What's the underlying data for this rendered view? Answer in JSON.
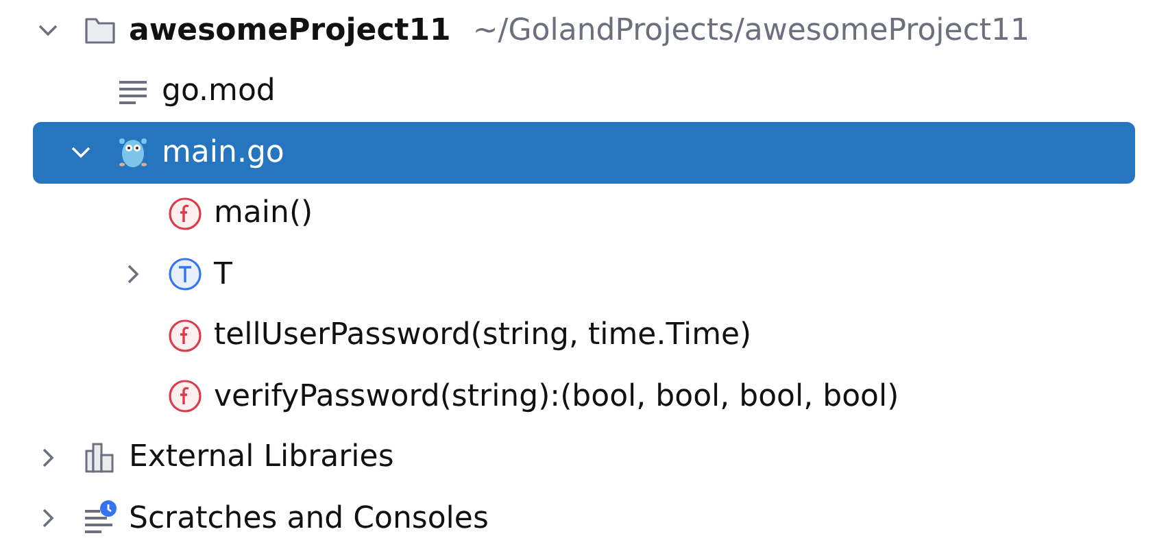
{
  "tree": [
    {
      "label": "awesomeProject11",
      "hint": "~/GolandProjects/awesomeProject11",
      "kind": "folder",
      "expanded": true,
      "selected": false,
      "children": [
        {
          "label": "go.mod",
          "kind": "text-file",
          "selected": false
        },
        {
          "label": "main.go",
          "kind": "gopher",
          "expanded": true,
          "selected": true,
          "children": [
            {
              "label": "main()",
              "kind": "function",
              "selected": false
            },
            {
              "label": "T",
              "kind": "type",
              "expanded": false,
              "selected": false
            },
            {
              "label": "tellUserPassword(string, time.Time)",
              "kind": "function",
              "selected": false
            },
            {
              "label": "verifyPassword(string):(bool, bool, bool, bool)",
              "kind": "function",
              "selected": false
            }
          ]
        }
      ]
    },
    {
      "label": "External Libraries",
      "kind": "libraries",
      "expanded": false,
      "selected": false
    },
    {
      "label": "Scratches and Consoles",
      "kind": "scratches",
      "expanded": false,
      "selected": false
    }
  ]
}
